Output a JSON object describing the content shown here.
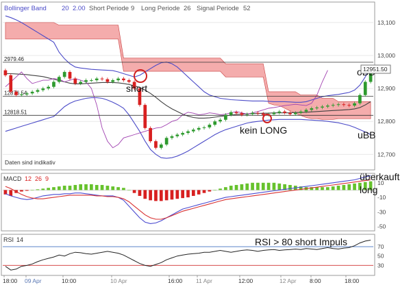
{
  "chart_data": [
    {
      "type": "candlestick",
      "panel": "price",
      "indicator_labels": [
        {
          "text": "Bollinger Band",
          "color": "#4b4bc8"
        },
        {
          "text": "20",
          "color": "#4b4bc8"
        },
        {
          "text": "2.00",
          "color": "#4b4bc8"
        },
        {
          "text": "Short Periode",
          "color": "#555555"
        },
        {
          "text": "9",
          "color": "#555555"
        },
        {
          "text": "Long Periode",
          "color": "#555555"
        },
        {
          "text": "26",
          "color": "#555555"
        },
        {
          "text": "Signal Periode",
          "color": "#555555"
        },
        {
          "text": "52",
          "color": "#555555"
        }
      ],
      "yticks": [
        12700,
        12800,
        12900,
        13000,
        13100
      ],
      "ylim": [
        12655,
        13160
      ],
      "level_lines": [
        {
          "label": "2979.46",
          "value": 12979.46
        },
        {
          "label": "12876.54",
          "value": 12876.54
        },
        {
          "label": "12818.51",
          "value": 12818.51
        }
      ],
      "last_price": {
        "label": "12951.50",
        "value": 12951.5
      },
      "footer_note": "Daten sind indikativ",
      "annotations": [
        "short",
        "kein LONG",
        "oBB",
        "uBB"
      ],
      "close": [
        12940,
        12890,
        12880,
        12882,
        12885,
        12890,
        12895,
        12900,
        12905,
        12920,
        12935,
        12950,
        12930,
        12915,
        12920,
        12925,
        12925,
        12930,
        12928,
        12920,
        12925,
        12930,
        12925,
        12920,
        12900,
        12850,
        12780,
        12740,
        12720,
        12730,
        12750,
        12755,
        12760,
        12765,
        12770,
        12775,
        12780,
        12782,
        12790,
        12800,
        12805,
        12820,
        12828,
        12825,
        12820,
        12822,
        12826,
        12824,
        12820,
        12822,
        12826,
        12830,
        12826,
        12822,
        12826,
        12830,
        12835,
        12840,
        12842,
        12845,
        12848,
        12850,
        12852,
        12850,
        12848,
        12855,
        12880,
        12920,
        12955
      ],
      "upper_band": [
        13120,
        13115,
        13108,
        13100,
        13090,
        13080,
        13070,
        13060,
        13050,
        13040,
        13010,
        12990,
        12975,
        12965,
        12962,
        12960,
        12958,
        12957,
        12956,
        12955,
        12954,
        12950,
        12945,
        12940,
        12935,
        12940,
        12950,
        12960,
        12970,
        12978,
        12980,
        12975,
        12965,
        12950,
        12935,
        12920,
        12905,
        12890,
        12880,
        12875,
        12870,
        12868,
        12866,
        12865,
        12864,
        12863,
        12862,
        12862,
        12862,
        12861,
        12860,
        12860,
        12860,
        12859,
        12858,
        12858,
        12860,
        12865,
        12870,
        12875,
        12878,
        12880,
        12882,
        12885,
        12888,
        12895,
        12910,
        12935,
        12965
      ],
      "lower_band": [
        12770,
        12775,
        12780,
        12785,
        12790,
        12795,
        12800,
        12805,
        12810,
        12815,
        12830,
        12845,
        12855,
        12862,
        12866,
        12870,
        12872,
        12872,
        12870,
        12865,
        12858,
        12850,
        12840,
        12820,
        12795,
        12770,
        12740,
        12715,
        12700,
        12690,
        12688,
        12690,
        12695,
        12702,
        12710,
        12720,
        12730,
        12740,
        12750,
        12760,
        12768,
        12775,
        12780,
        12785,
        12790,
        12795,
        12798,
        12800,
        12802,
        12804,
        12805,
        12806,
        12806,
        12806,
        12806,
        12806,
        12805,
        12804,
        12803,
        12802,
        12800,
        12798,
        12796,
        12792,
        12788,
        12782,
        12775,
        12768,
        12760
      ],
      "middle_band": [
        12945,
        12945,
        12944,
        12943,
        12942,
        12940,
        12938,
        12936,
        12932,
        12928,
        12924,
        12920,
        12916,
        12914,
        12914,
        12915,
        12916,
        12917,
        12918,
        12918,
        12918,
        12917,
        12915,
        12912,
        12908,
        12903,
        12895,
        12885,
        12873,
        12860,
        12848,
        12838,
        12830,
        12822,
        12816,
        12812,
        12810,
        12810,
        12811,
        12813,
        12815,
        12817,
        12819,
        12821,
        12822,
        12823,
        12824,
        12824,
        12825,
        12825,
        12826,
        12826,
        12826,
        12826,
        12827,
        12827,
        12828,
        12829,
        12830,
        12831,
        12832,
        12833,
        12834,
        12835,
        12836,
        12838,
        12842,
        12850,
        12860
      ],
      "cloud_upper": [
        13100,
        13100,
        13100,
        13100,
        13100,
        13100,
        13100,
        13100,
        13100,
        13100,
        13092,
        13092,
        13092,
        13092,
        13092,
        13092,
        13092,
        13092,
        13092,
        13092,
        13092,
        13092,
        12992,
        12992,
        12992,
        12992,
        12992,
        12992,
        12992,
        12992,
        12992,
        12992,
        12992,
        12992,
        12992,
        12992,
        12992,
        12992,
        12992,
        12992,
        12992,
        12975,
        12975,
        12975,
        12975,
        12975,
        12975,
        12975,
        12975,
        12890,
        12890,
        12890,
        12890,
        12890,
        12890,
        12880,
        12880,
        12880,
        12880,
        12870,
        12870,
        12870,
        12860,
        12860,
        12860,
        12860,
        12860,
        12860,
        12860
      ],
      "cloud_lower": [
        13050,
        13050,
        13050,
        13050,
        13050,
        13050,
        13050,
        13050,
        13050,
        13050,
        13050,
        13050,
        13050,
        13050,
        13050,
        13050,
        13050,
        13050,
        13050,
        13050,
        13050,
        13050,
        12952,
        12952,
        12952,
        12952,
        12952,
        12952,
        12952,
        12952,
        12952,
        12952,
        12952,
        12952,
        12952,
        12952,
        12952,
        12952,
        12952,
        12952,
        12952,
        12935,
        12935,
        12935,
        12935,
        12935,
        12935,
        12935,
        12935,
        12855,
        12850,
        12848,
        12840,
        12832,
        12825,
        12818,
        12812,
        12808,
        12808,
        12806,
        12806,
        12806,
        12808,
        12808,
        12808,
        12808,
        12808,
        12808,
        12808
      ]
    },
    {
      "type": "bar+line",
      "panel": "macd",
      "label": "MACD",
      "params": [
        "12",
        "26",
        "9"
      ],
      "yticks": [
        10,
        -10,
        -30,
        -50
      ],
      "ylim": [
        -55,
        22
      ],
      "histogram": [
        -6,
        -8,
        -4,
        -2,
        -1,
        0,
        1,
        2,
        3,
        4,
        5,
        6,
        6,
        7,
        8,
        8,
        8,
        7,
        7,
        6,
        5,
        4,
        3,
        0,
        -4,
        -8,
        -12,
        -14,
        -15,
        -15,
        -14,
        -13,
        -12,
        -11,
        -10,
        -8,
        -6,
        -4,
        -2,
        0,
        2,
        4,
        6,
        7,
        8,
        9,
        10,
        10,
        10,
        10,
        10,
        9,
        8,
        7,
        6,
        5,
        4,
        4,
        4,
        4,
        4,
        5,
        6,
        7,
        8,
        9,
        10,
        11,
        12
      ],
      "macd_line": [
        -5,
        -8,
        -10,
        -12,
        -13,
        -12,
        -10,
        -8,
        -7,
        -6,
        -6,
        -5,
        -5,
        -4,
        -4,
        -5,
        -6,
        -7,
        -8,
        -8,
        -8,
        -10,
        -14,
        -22,
        -30,
        -38,
        -44,
        -46,
        -45,
        -42,
        -38,
        -34,
        -30,
        -26,
        -24,
        -22,
        -20,
        -18,
        -16,
        -14,
        -12,
        -10,
        -9,
        -8,
        -7,
        -6,
        -5,
        -4,
        -3,
        -2,
        -1,
        0,
        1,
        2,
        3,
        4,
        5,
        6,
        7,
        8,
        9,
        10,
        11,
        12,
        13,
        14,
        16,
        18,
        20
      ],
      "signal_line": [
        5,
        2,
        -2,
        -6,
        -9,
        -11,
        -12,
        -12,
        -11,
        -10,
        -9,
        -8,
        -7,
        -7,
        -7,
        -7,
        -7,
        -8,
        -8,
        -9,
        -9,
        -10,
        -12,
        -16,
        -22,
        -28,
        -34,
        -38,
        -40,
        -40,
        -38,
        -35,
        -32,
        -29,
        -27,
        -25,
        -23,
        -21,
        -19,
        -17,
        -15,
        -13,
        -12,
        -11,
        -10,
        -9,
        -8,
        -7,
        -6,
        -5,
        -4,
        -3,
        -2,
        -1,
        0,
        1,
        2,
        3,
        4,
        5,
        6,
        7,
        8,
        9,
        10,
        11,
        12,
        13,
        14
      ],
      "annotations": [
        "überkauft",
        "long"
      ]
    },
    {
      "type": "line",
      "panel": "rsi",
      "label": "RSI",
      "period": "14",
      "yticks": [
        70,
        50,
        30
      ],
      "ylim": [
        10,
        95
      ],
      "values": [
        28,
        20,
        22,
        28,
        30,
        33,
        38,
        42,
        45,
        48,
        52,
        50,
        55,
        58,
        57,
        55,
        54,
        56,
        58,
        60,
        58,
        56,
        52,
        46,
        40,
        34,
        30,
        28,
        32,
        36,
        42,
        46,
        50,
        52,
        54,
        55,
        56,
        58,
        58,
        60,
        62,
        60,
        58,
        60,
        62,
        63,
        62,
        60,
        62,
        63,
        64,
        62,
        63,
        64,
        65,
        64,
        66,
        65,
        64,
        66,
        68,
        66,
        65,
        67,
        68,
        72,
        78,
        82,
        84
      ],
      "annotation": "RSI > 80 short Impuls"
    }
  ],
  "x_axis": {
    "tick_labels": [
      {
        "text": "18:00",
        "color": "#333333"
      },
      {
        "text": "09 Apr",
        "color": "#5a78b4"
      },
      {
        "text": "10:00",
        "color": "#333333"
      },
      {
        "text": "10 Apr",
        "color": "#888888"
      },
      {
        "text": "16:00",
        "color": "#333333"
      },
      {
        "text": "11 Apr",
        "color": "#888888"
      },
      {
        "text": "12:00",
        "color": "#333333"
      },
      {
        "text": "12 Apr",
        "color": "#888888"
      },
      {
        "text": "8:00",
        "color": "#333333"
      },
      {
        "text": "18:00",
        "color": "#333333"
      }
    ]
  },
  "colors": {
    "up": "#2e9a2e",
    "down": "#d82020",
    "bollinger": "#4b4bc8",
    "cloud": "#f09090",
    "cloud_edge": "#c84040",
    "ma_dark": "#404040",
    "ma_purple": "#a040b0",
    "macd_pos": "#66c22c",
    "macd_neg": "#d82020",
    "rsi": "#222222",
    "rsi_upper": "#4070c0",
    "rsi_lower": "#d03030",
    "marker": "#d02020"
  }
}
